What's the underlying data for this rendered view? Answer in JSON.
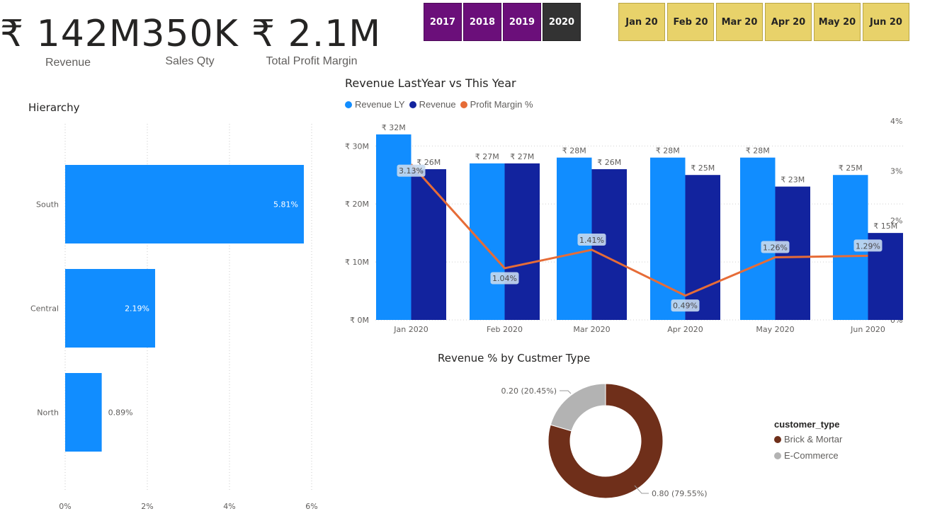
{
  "kpis": [
    {
      "value": "₹ 142M",
      "label": "Revenue"
    },
    {
      "value": "350K",
      "label": "Sales Qty"
    },
    {
      "value": "₹ 2.1M",
      "label": "Total Profit Margin"
    }
  ],
  "year_slicer": [
    {
      "label": "2017",
      "selected": false
    },
    {
      "label": "2018",
      "selected": false
    },
    {
      "label": "2019",
      "selected": false
    },
    {
      "label": "2020",
      "selected": true
    }
  ],
  "month_slicer": [
    "Jan 20",
    "Feb 20",
    "Mar 20",
    "Apr 20",
    "May 20",
    "Jun 20"
  ],
  "chart_data": [
    {
      "type": "bar",
      "orientation": "horizontal",
      "title": "Hierarchy",
      "categories": [
        "South",
        "Central",
        "North"
      ],
      "values": [
        5.81,
        2.19,
        0.89
      ],
      "value_labels": [
        "5.81%",
        "2.19%",
        "0.89%"
      ],
      "xticks": [
        "0%",
        "2%",
        "4%",
        "6%"
      ],
      "xlim": [
        0,
        6
      ],
      "grid": true,
      "color": "#118dff"
    },
    {
      "type": "bar",
      "title": "Revenue LastYear vs This Year",
      "categories": [
        "Jan 2020",
        "Feb 2020",
        "Mar 2020",
        "Apr 2020",
        "May 2020",
        "Jun 2020"
      ],
      "series": [
        {
          "name": "Revenue LY",
          "kind": "bar",
          "color": "#118dff",
          "values": [
            32,
            27,
            28,
            28,
            28,
            25
          ],
          "labels": [
            "₹ 32M",
            "₹ 27M",
            "₹ 28M",
            "₹ 28M",
            "₹ 28M",
            "₹ 25M"
          ]
        },
        {
          "name": "Revenue",
          "kind": "bar",
          "color": "#12239e",
          "values": [
            26,
            27,
            26,
            25,
            23,
            15
          ],
          "labels": [
            "₹ 26M",
            "₹ 27M",
            "₹ 26M",
            "₹ 25M",
            "₹ 23M",
            "₹ 15M"
          ]
        },
        {
          "name": "Profit Margin %",
          "kind": "line",
          "axis": "right",
          "color": "#e66c37",
          "values": [
            3.13,
            1.04,
            1.41,
            0.49,
            1.26,
            1.29
          ],
          "labels": [
            "3.13%",
            "1.04%",
            "1.41%",
            "0.49%",
            "1.26%",
            "1.29%"
          ]
        }
      ],
      "yticks_left": [
        "₹ 0M",
        "₹ 10M",
        "₹ 20M",
        "₹ 30M"
      ],
      "ylim_left": [
        0,
        34.5
      ],
      "yticks_right": [
        "0%",
        "1%",
        "2%",
        "3%",
        "4%"
      ],
      "ylim_right": [
        0,
        4
      ],
      "legend": "top-left",
      "grid": true
    },
    {
      "type": "pie",
      "variant": "donut",
      "title": "Revenue % by Custmer Type",
      "legend_title": "customer_type",
      "legend": "right",
      "slices": [
        {
          "name": "Brick & Mortar",
          "value": 0.8,
          "percent": 79.55,
          "label": "0.80 (79.55%)",
          "color": "#6f2f1a"
        },
        {
          "name": "E-Commerce",
          "value": 0.2,
          "percent": 20.45,
          "label": "0.20 (20.45%)",
          "color": "#b3b3b3"
        }
      ]
    }
  ]
}
